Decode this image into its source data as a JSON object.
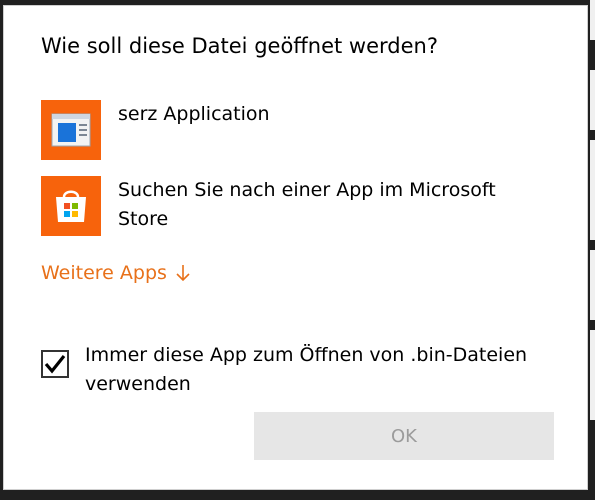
{
  "dialog": {
    "title": "Wie soll diese Datei geöffnet werden?",
    "apps": [
      {
        "label": "serz Application",
        "icon": "application-window-icon"
      },
      {
        "label": "Suchen Sie nach einer App im Microsoft Store",
        "icon": "microsoft-store-bag-icon"
      }
    ],
    "more_apps_label": "Weitere Apps",
    "more_apps_icon": "arrow-down-icon",
    "always_use_label": "Immer diese App zum Öffnen von .bin-Dateien verwenden",
    "always_use_checked": true,
    "ok_label": "OK"
  },
  "colors": {
    "accent": "#f7630c",
    "link": "#e8711a",
    "button_disabled_bg": "#e6e6e6",
    "button_disabled_text": "#9b9b9b"
  }
}
